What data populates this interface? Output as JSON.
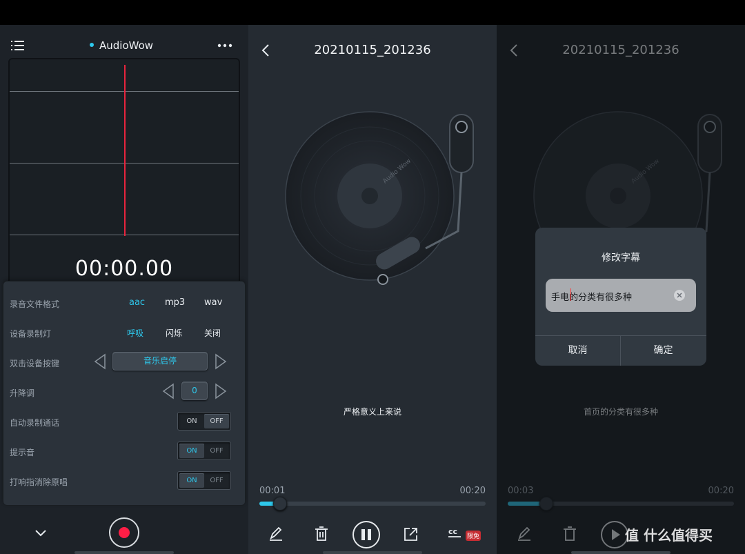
{
  "left_panel": {
    "app_title": "AudioWow",
    "timer": "00:00.00",
    "settings": [
      {
        "label": "录音文件格式",
        "options": [
          "aac",
          "mp3",
          "wav"
        ],
        "selected": "aac"
      },
      {
        "label": "设备录制灯",
        "options": [
          "呼吸",
          "闪烁",
          "关闭"
        ],
        "selected": "呼吸"
      },
      {
        "label": "双击设备按键",
        "value": "音乐启停"
      },
      {
        "label": "升降调",
        "value": "0"
      },
      {
        "label": "自动录制通话",
        "on": "ON",
        "off": "OFF",
        "state": "OFF"
      },
      {
        "label": "提示音",
        "on": "ON",
        "off": "OFF",
        "state": "ON"
      },
      {
        "label": "打响指消除原唱",
        "on": "ON",
        "off": "OFF",
        "state": "ON"
      }
    ],
    "icons": [
      "list-menu-icon",
      "more-icon",
      "chevron-down-icon",
      "record-icon"
    ]
  },
  "middle_panel": {
    "title": "20210115_201236",
    "record_label": "Audio Wow",
    "subtitle": "严格意义上来说",
    "time_current": "00:01",
    "time_total": "00:20",
    "progress": 0.05,
    "toolbar": {
      "icons": [
        "edit-icon",
        "delete-icon",
        "pause-icon",
        "share-icon",
        "subtitle-cc-icon"
      ],
      "badge": "限免"
    }
  },
  "right_panel": {
    "title": "20210115_201236",
    "record_label": "Audio Wow",
    "subtitle": "首页的分类有很多种",
    "time_current": "00:03",
    "time_total": "00:20",
    "progress": 0.15,
    "dialog": {
      "title": "修改字幕",
      "input_value": "手电的分类有很多种",
      "cancel_label": "取消",
      "confirm_label": "确定"
    },
    "toolbar": {
      "icons": [
        "edit-icon",
        "delete-icon",
        "play-icon"
      ]
    }
  },
  "watermark": "值 什么值得买",
  "colors": {
    "accent": "#2ec8ec",
    "record_red": "#ff1e46",
    "playhead": "#e8243d",
    "badge": "#c62d33"
  }
}
